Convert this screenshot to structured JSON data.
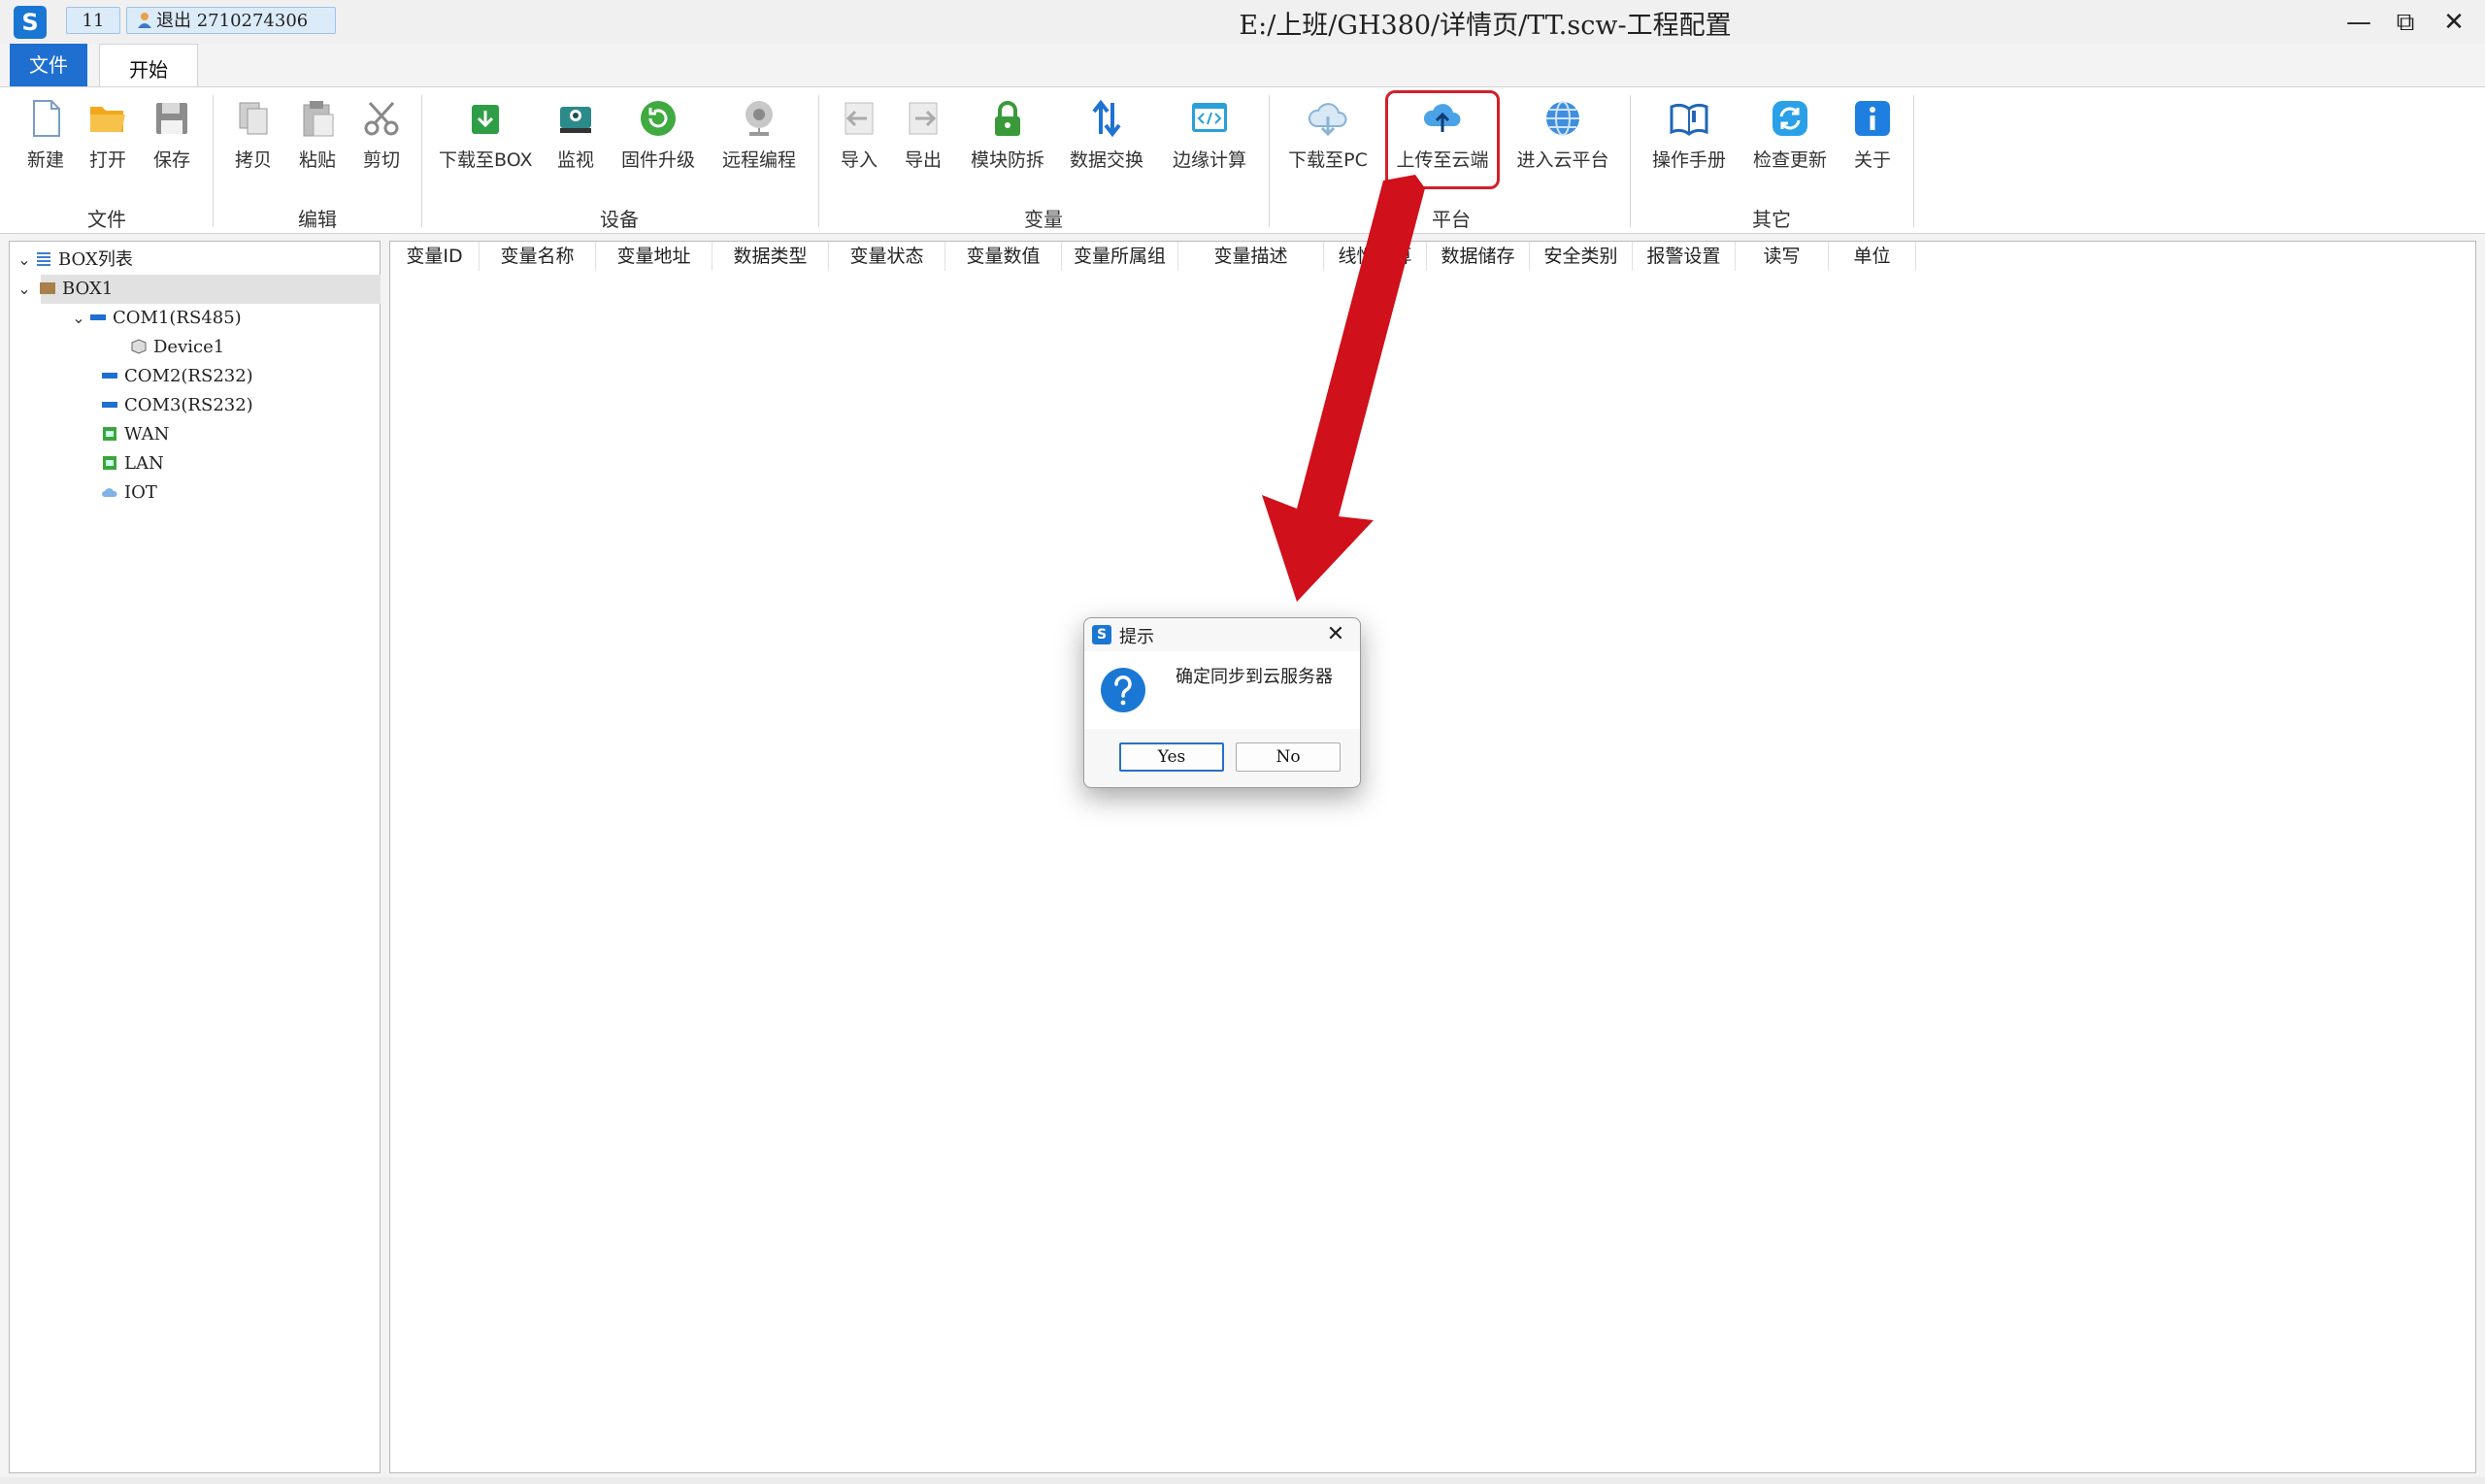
{
  "window": {
    "qa_count": "11",
    "qa_user": "退出 2710274306",
    "title": "E:/上班/GH380/详情页/TT.scw-工程配置",
    "min_glyph": "—",
    "max_glyph": "⧉",
    "close_glyph": "✕"
  },
  "ribbon": {
    "tabs": {
      "file": "文件",
      "home": "开始"
    },
    "groups": {
      "file": "文件",
      "edit": "编辑",
      "device": "设备",
      "variable": "变量",
      "platform": "平台",
      "other": "其它"
    },
    "buttons": {
      "new": "新建",
      "open": "打开",
      "save": "保存",
      "copy": "拷贝",
      "paste": "粘贴",
      "cut": "剪切",
      "download_box": "下载至BOX",
      "monitor": "监视",
      "firmware": "固件升级",
      "remote": "远程编程",
      "import": "导入",
      "export": "导出",
      "module_protect": "模块防拆",
      "data_exchange": "数据交换",
      "edge_compute": "边缘计算",
      "download_pc": "下载至PC",
      "upload_cloud": "上传至云端",
      "enter_cloud": "进入云平台",
      "manual": "操作手册",
      "check_update": "检查更新",
      "about": "关于"
    }
  },
  "tree": {
    "root": "BOX列表",
    "box1": "BOX1",
    "com1": "COM1(RS485)",
    "device1": "Device1",
    "com2": "COM2(RS232)",
    "com3": "COM3(RS232)",
    "wan": "WAN",
    "lan": "LAN",
    "iot": "IOT"
  },
  "table": {
    "columns": [
      "变量ID",
      "变量名称",
      "变量地址",
      "数据类型",
      "变量状态",
      "变量数值",
      "变量所属组",
      "变量描述",
      "线性换算",
      "数据储存",
      "安全类别",
      "报警设置",
      "读写",
      "单位"
    ]
  },
  "dialog": {
    "title": "提示",
    "message": "确定同步到云服务器",
    "yes": "Yes",
    "no": "No",
    "close_glyph": "✕"
  },
  "colors": {
    "accent_blue": "#1f6fd1",
    "highlight_red": "#d2202a",
    "arrow_red": "#d0101a"
  }
}
